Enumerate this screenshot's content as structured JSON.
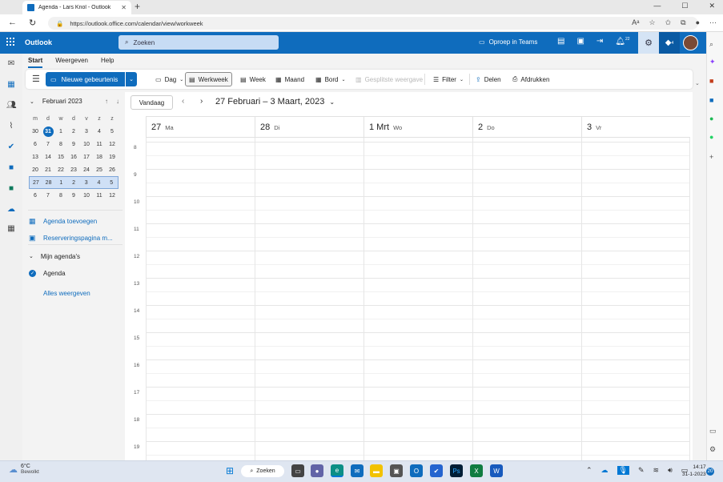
{
  "browser": {
    "tab_title": "Agenda - Lars Knol - Outlook",
    "url": "https://outlook.office.com/calendar/view/workweek"
  },
  "header": {
    "app_name": "Outlook",
    "search_placeholder": "Zoeken",
    "teams_call": "Oproep in Teams",
    "notif_count": "22",
    "premium_count": "4"
  },
  "ribbon": {
    "tabs": [
      "Start",
      "Weergeven",
      "Help"
    ],
    "new_event": "Nieuwe gebeurtenis",
    "views": {
      "day": "Dag",
      "workweek": "Werkweek",
      "week": "Week",
      "month": "Maand",
      "board": "Bord",
      "split": "Gesplitste weergave"
    },
    "filter": "Filter",
    "share": "Delen",
    "print": "Afdrukken"
  },
  "mini_calendar": {
    "month": "Februari 2023",
    "weekdays": [
      "m",
      "d",
      "w",
      "d",
      "v",
      "z",
      "z"
    ],
    "weeks": [
      [
        "30",
        "31",
        "1",
        "2",
        "3",
        "4",
        "5"
      ],
      [
        "6",
        "7",
        "8",
        "9",
        "10",
        "11",
        "12"
      ],
      [
        "13",
        "14",
        "15",
        "16",
        "17",
        "18",
        "19"
      ],
      [
        "20",
        "21",
        "22",
        "23",
        "24",
        "25",
        "26"
      ],
      [
        "27",
        "28",
        "1",
        "2",
        "3",
        "4",
        "5"
      ],
      [
        "6",
        "7",
        "8",
        "9",
        "10",
        "11",
        "12"
      ]
    ],
    "today": "31",
    "selected_week_index": 4
  },
  "left_links": {
    "add_calendar": "Agenda toevoegen",
    "booking_page": "Reserveringspagina m...",
    "my_calendars": "Mijn agenda's",
    "calendar": "Agenda",
    "show_all": "Alles weergeven"
  },
  "calendar": {
    "today_button": "Vandaag",
    "range": "27 Februari – 3 Maart, 2023",
    "days": [
      {
        "num": "27",
        "name": "Ma"
      },
      {
        "num": "28",
        "name": "Di"
      },
      {
        "num": "1 Mrt",
        "name": "Wo"
      },
      {
        "num": "2",
        "name": "Do"
      },
      {
        "num": "3",
        "name": "Vr"
      }
    ],
    "hours": [
      "8",
      "9",
      "10",
      "11",
      "12",
      "13",
      "14",
      "15",
      "16",
      "17",
      "18",
      "19"
    ]
  },
  "taskbar": {
    "temp": "6°C",
    "weather": "Bewolkt",
    "search": "Zoeken",
    "time": "14:17",
    "date": "31-1-2023",
    "notif": "20"
  },
  "colors": {
    "accent": "#0f6cbd",
    "selected_week": "#cfe0f6"
  }
}
